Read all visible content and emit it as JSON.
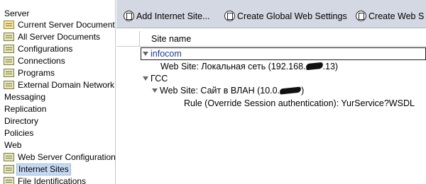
{
  "navigator": {
    "items": [
      {
        "label": "Server",
        "icon": null,
        "selected": false
      },
      {
        "label": "Current Server Document",
        "icon": "server-document-icon",
        "selected": false
      },
      {
        "label": "All Server Documents",
        "icon": "view-icon",
        "selected": false
      },
      {
        "label": "Configurations",
        "icon": "view-icon",
        "selected": false
      },
      {
        "label": "Connections",
        "icon": "view-icon",
        "selected": false
      },
      {
        "label": "Programs",
        "icon": "view-icon",
        "selected": false
      },
      {
        "label": "External Domain Network Info",
        "icon": "view-icon",
        "selected": false
      },
      {
        "label": "Messaging",
        "icon": null,
        "selected": false
      },
      {
        "label": "Replication",
        "icon": null,
        "selected": false
      },
      {
        "label": "Directory",
        "icon": null,
        "selected": false
      },
      {
        "label": "Policies",
        "icon": null,
        "selected": false
      },
      {
        "label": "Web",
        "icon": null,
        "selected": false
      },
      {
        "label": "Web Server Configurations",
        "icon": "view-icon",
        "selected": false
      },
      {
        "label": "Internet Sites",
        "icon": "view-icon",
        "selected": true
      },
      {
        "label": "File Identifications",
        "icon": "view-icon",
        "selected": false
      }
    ]
  },
  "actions": [
    {
      "label": "Add Internet Site...",
      "icon": "document-button-icon"
    },
    {
      "label": "Create Global Web Settings",
      "icon": "document-button-icon"
    },
    {
      "label": "Create Web S",
      "icon": "document-button-icon"
    }
  ],
  "view": {
    "column_header": "Site name",
    "rows": [
      {
        "text": "infocom",
        "level": 0,
        "category": true
      },
      {
        "text": "Web Site: Локальная сеть (192.168.",
        "suffix": ".13)",
        "level": 1,
        "category": false
      },
      {
        "text": "ГСС",
        "level": 0,
        "category": true
      },
      {
        "text": "Web Site: Сайт в ВЛАН (10.0.",
        "suffix": ")",
        "level": 1,
        "category": true
      },
      {
        "text": "Rule (Override Session authentication): YurService?WSDL",
        "level": 2,
        "category": false
      }
    ]
  }
}
